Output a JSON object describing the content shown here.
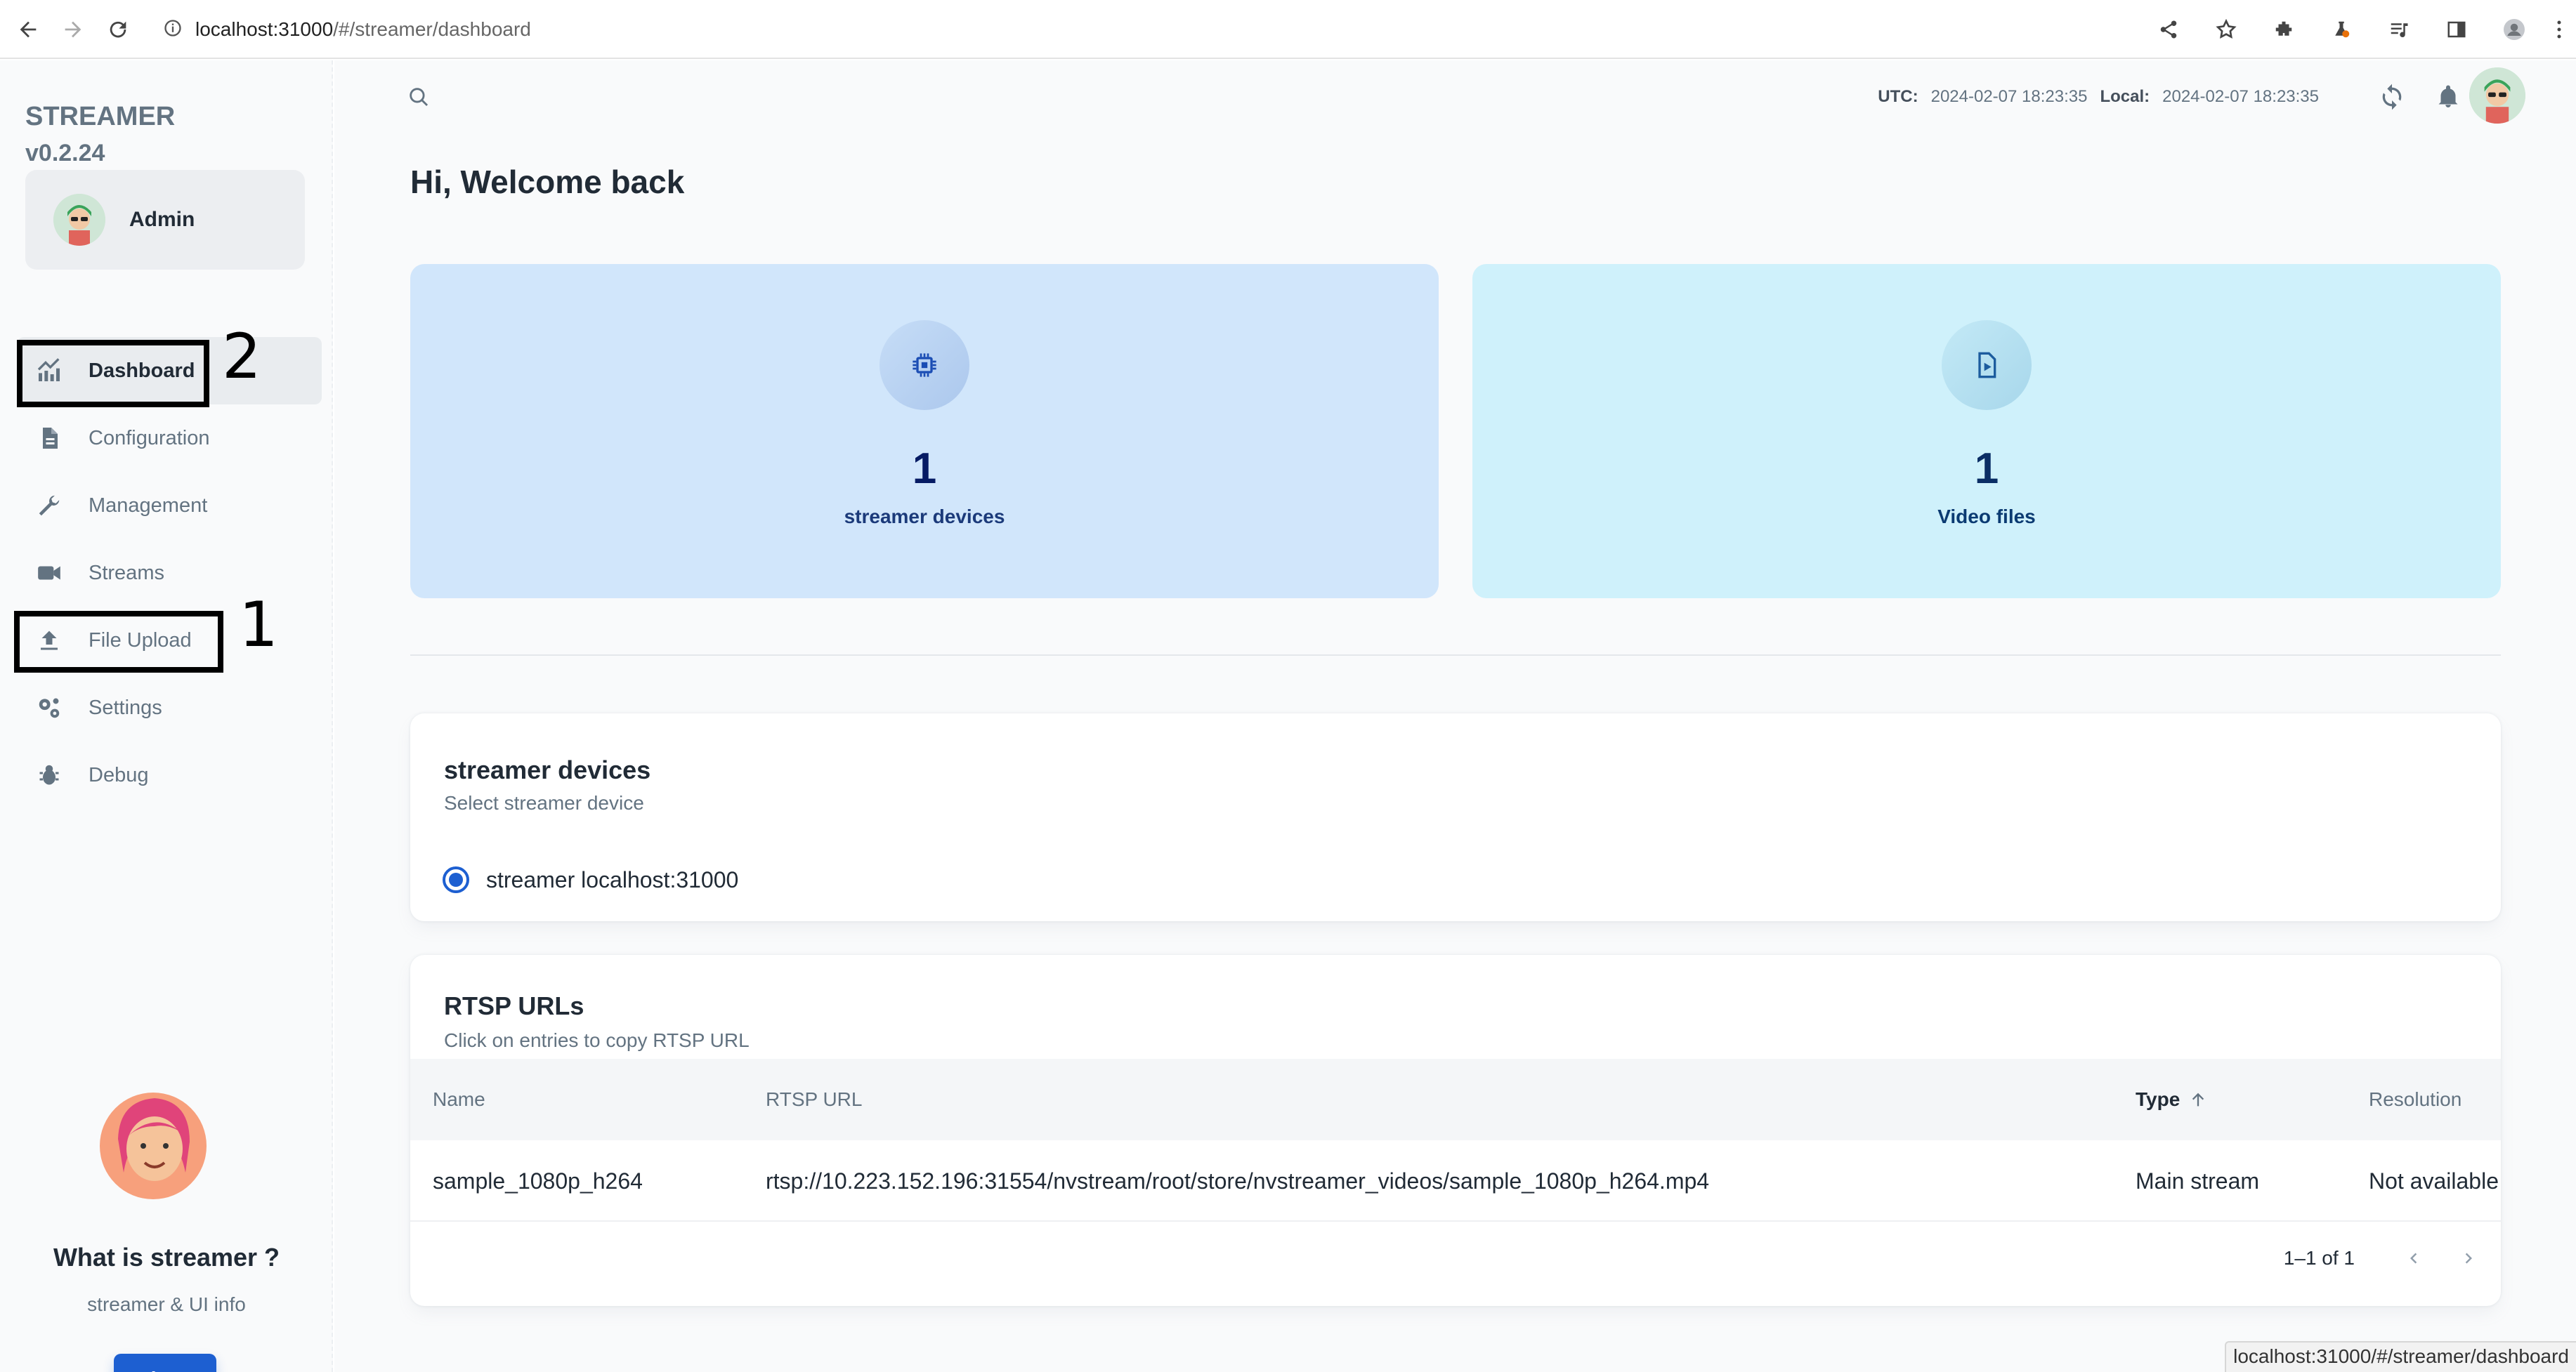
{
  "browser": {
    "url_host": "localhost:31000",
    "url_path": "/#/streamer/dashboard",
    "status_url": "localhost:31000/#/streamer/dashboard"
  },
  "sidebar": {
    "brand_name": "STREAMER",
    "version": "v0.2.24",
    "user_name": "Admin",
    "items": [
      {
        "label": "Dashboard",
        "icon": "chart-icon",
        "active": true
      },
      {
        "label": "Configuration",
        "icon": "document-icon"
      },
      {
        "label": "Management",
        "icon": "wrench-icon"
      },
      {
        "label": "Streams",
        "icon": "video-camera-icon"
      },
      {
        "label": "File Upload",
        "icon": "upload-icon"
      },
      {
        "label": "Settings",
        "icon": "gears-icon"
      },
      {
        "label": "Debug",
        "icon": "bug-icon"
      }
    ],
    "promo_title": "What is streamer ?",
    "promo_subtitle": "streamer & UI info",
    "about_label": "About"
  },
  "annotations": {
    "dashboard_marker": "2",
    "file_upload_marker": "1"
  },
  "topbar": {
    "utc_label": "UTC:",
    "utc_time": "2024-02-07 18:23:35",
    "local_label": "Local:",
    "local_time": "2024-02-07 18:23:35"
  },
  "main": {
    "welcome": "Hi, Welcome back",
    "stats": [
      {
        "value": "1",
        "label": "streamer devices",
        "icon": "chip-icon"
      },
      {
        "value": "1",
        "label": "Video files",
        "icon": "video-file-icon"
      }
    ]
  },
  "devices_panel": {
    "title": "streamer devices",
    "subtitle": "Select streamer device",
    "option_label": "streamer localhost:31000",
    "selected": true
  },
  "rtsp_panel": {
    "title": "RTSP URLs",
    "subtitle": "Click on entries to copy RTSP URL",
    "columns": [
      "Name",
      "RTSP URL",
      "Type",
      "Resolution"
    ],
    "rows": [
      {
        "name": "sample_1080p_h264",
        "url": "rtsp://10.223.152.196:31554/nvstream/root/store/nvstreamer_videos/sample_1080p_h264.mp4",
        "type": "Main stream",
        "resolution": "Not available"
      }
    ],
    "pagination": "1–1 of 1"
  },
  "colors": {
    "accent": "#1d5fd1",
    "stat_blue": "#d1e6fb",
    "stat_cyan": "#cff1fb"
  }
}
